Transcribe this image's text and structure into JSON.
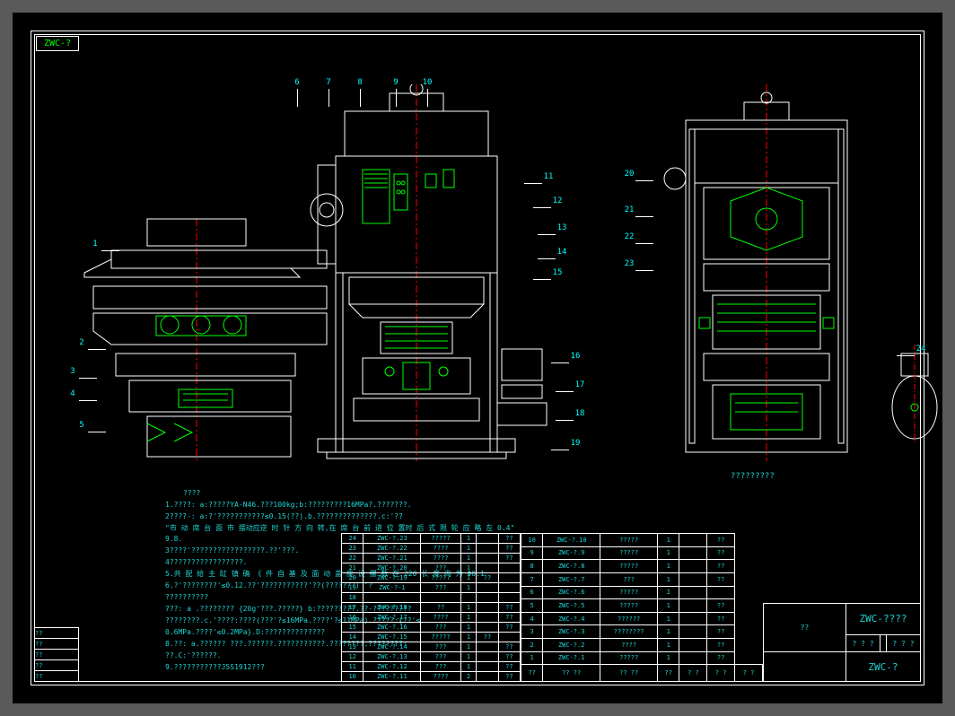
{
  "tab_label": "ZWC-?",
  "view2_label": "?????????",
  "detail_label": "24",
  "callouts": {
    "c1": "1",
    "c2": "2",
    "c3": "3",
    "c4": "4",
    "c5": "5",
    "c6": "6",
    "c7": "7",
    "c8": "8",
    "c9": "9",
    "c10": "10",
    "c11": "11",
    "c12": "12",
    "c13": "13",
    "c14": "14",
    "c15": "15",
    "c16": "16",
    "c17": "17",
    "c18": "18",
    "c19": "19",
    "c20": "20",
    "c21": "21",
    "c22": "22",
    "c23": "23",
    "c24": "24"
  },
  "notes": {
    "title": "????",
    "n1": "1.????: a:?????YA-N46.???100kg;b:?????????16MPa?.???????.",
    "n2": "2????-: a:?'???????????≤0.15(??).b.??????????????.c:'??",
    "n2b": "\"市 动 席 台 面 市 摆动应逆 时 针 方 向 转,在 席 台 前 进 位 置时 后 式 限 轮 应 略 左 0.4\" 9.8.",
    "n3": "3????'?????????????????.??'???.",
    "n4": "4?????????????????.",
    "n5": "5.共 配 给 主 缸 镇 确 《 件 自 基 及 面 动 盖 座 设 摆 数 在 220 长 度 内 为 Φ0.1",
    "n5b": "6.?'????????'≤0.12.??'???????????'??(???????) '?",
    "n6": "??????????",
    "n7": "7??: a .???????? {20g'???.?????} b:?????????.??-?????????",
    "n7b": "????????.c.'????:????(???'?≤16MPa.????'?≤11MPa).?????:{??'≤",
    "n7c": "0.6MPa.????'≤0.2MPa}.D:??????????????",
    "n8": "8.??: a.?????? ???.??????.???????????.????????.????????:",
    "n8b": "??.C:'??????.",
    "n9": "9.???????????J5S1912???"
  },
  "bom_left": [
    {
      "no": "24",
      "code": "ZWC-?.23",
      "name": "?????",
      "q": "1",
      "mat": "",
      "wt": "??"
    },
    {
      "no": "23",
      "code": "ZWC-?.22",
      "name": "????",
      "q": "1",
      "mat": "",
      "wt": "??"
    },
    {
      "no": "22",
      "code": "ZWC-?.21",
      "name": "????",
      "q": "1",
      "mat": "",
      "wt": "??"
    },
    {
      "no": "21",
      "code": "ZWC-?.20",
      "name": "???",
      "q": "1",
      "mat": "",
      "wt": ""
    },
    {
      "no": "20",
      "code": "ZWC-?.19",
      "name": "?????",
      "q": "1",
      "mat": "??",
      "wt": ""
    },
    {
      "no": "19",
      "code": "ZWC-?-1",
      "name": "???",
      "q": "1",
      "mat": "",
      "wt": ""
    },
    {
      "no": "18",
      "code": "",
      "name": "",
      "q": "",
      "mat": "",
      "wt": ""
    },
    {
      "no": "17",
      "code": "ZWC-?.18",
      "name": "??",
      "q": "1",
      "mat": "",
      "wt": "??"
    },
    {
      "no": "16",
      "code": "ZWC-?.17",
      "name": "????",
      "q": "1",
      "mat": "",
      "wt": "??"
    },
    {
      "no": "15",
      "code": "ZWC-?.16",
      "name": "???",
      "q": "1",
      "mat": "",
      "wt": "??"
    },
    {
      "no": "14",
      "code": "ZWC-?.15",
      "name": "?????",
      "q": "1",
      "mat": "??",
      "wt": ""
    },
    {
      "no": "13",
      "code": "ZWC-?.14",
      "name": "???",
      "q": "1",
      "mat": "",
      "wt": "??"
    },
    {
      "no": "12",
      "code": "ZWC-?.13",
      "name": "???",
      "q": "1",
      "mat": "",
      "wt": "??"
    },
    {
      "no": "11",
      "code": "ZWC-?.12",
      "name": "???",
      "q": "1",
      "mat": "",
      "wt": "??"
    },
    {
      "no": "10",
      "code": "ZWC-?.11",
      "name": "????",
      "q": "2",
      "mat": "",
      "wt": "??"
    }
  ],
  "bom_right": [
    {
      "no": "10",
      "code": "ZWC-?.10",
      "name": "?????",
      "q": "1",
      "mat": "",
      "wt": "??"
    },
    {
      "no": "9",
      "code": "ZWC-?.9",
      "name": "?????",
      "q": "1",
      "mat": "",
      "wt": "??"
    },
    {
      "no": "8",
      "code": "ZWC-?.8",
      "name": "?????",
      "q": "1",
      "mat": "",
      "wt": "??"
    },
    {
      "no": "7",
      "code": "ZWC-?.7",
      "name": "???",
      "q": "1",
      "mat": "",
      "wt": "??"
    },
    {
      "no": "6",
      "code": "ZWC-?.6",
      "name": "?????",
      "q": "1",
      "mat": "",
      "wt": ""
    },
    {
      "no": "5",
      "code": "ZWC-?.5",
      "name": "?????",
      "q": "1",
      "mat": "",
      "wt": "??"
    },
    {
      "no": "4",
      "code": "ZWC-?.4",
      "name": "??????",
      "q": "1",
      "mat": "",
      "wt": "??"
    },
    {
      "no": "3",
      "code": "ZWC-?.3",
      "name": "????????",
      "q": "1",
      "mat": "",
      "wt": "??"
    },
    {
      "no": "2",
      "code": "ZWC-?.2",
      "name": "????",
      "q": "1",
      "mat": "",
      "wt": "??"
    },
    {
      "no": "1",
      "code": "ZWC-?.1",
      "name": "?????",
      "q": "1",
      "mat": "",
      "wt": "??"
    }
  ],
  "bom_header": {
    "no": "??",
    "code": "?? ??",
    "name": "?? ??",
    "q": "??",
    "mat": "? ?",
    "wt": "? ?",
    "rem": "? ?"
  },
  "title_block": {
    "name": "??",
    "code": "ZWC-????",
    "model": "ZWC-?",
    "scale": "??",
    "sheet": "",
    "mass": "? ? ?",
    "page": "? ? ?"
  },
  "rev_table": {
    "r1": "??",
    "r2": "??",
    "r3": "??",
    "r4": "??",
    "r5": "??"
  }
}
